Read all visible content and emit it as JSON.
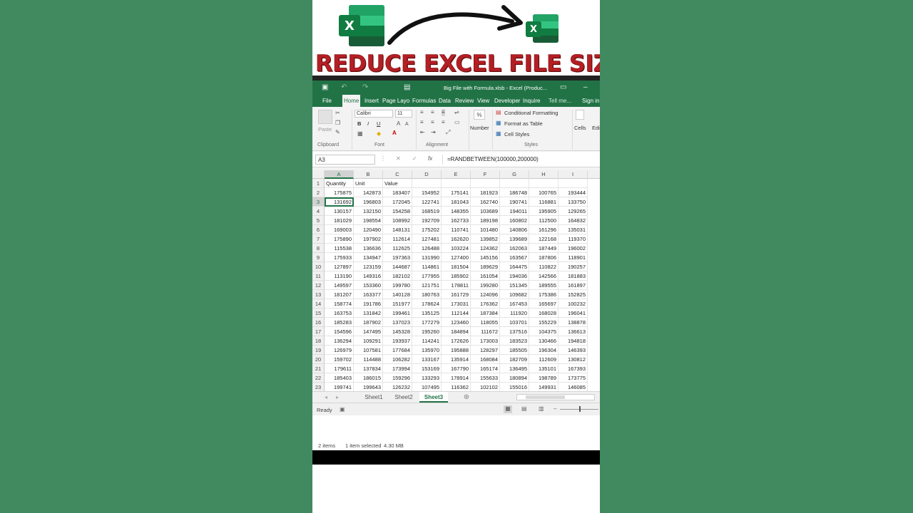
{
  "banner": {
    "headline": "REDUCE EXCEL FILE SIZE",
    "logo_letter": "X",
    "brand_color": "#107c41",
    "headline_color": "#b51f24"
  },
  "titlebar": {
    "title": "Big File with Formula.xlsb - Excel (Produc...",
    "icons": [
      "save-icon",
      "undo-icon",
      "redo-icon",
      "customize-icon",
      "ribbon-display-icon",
      "minimize-icon"
    ]
  },
  "menu": {
    "items": [
      "File",
      "Home",
      "Insert",
      "Page Layo",
      "Formulas",
      "Data",
      "Review",
      "View",
      "Developer",
      "Inquire",
      "Tell me...",
      "Sign in"
    ],
    "active": "Home"
  },
  "ribbon": {
    "paste": "Paste",
    "font_name": "Calibri",
    "font_size": "11",
    "bold": "B",
    "italic": "I",
    "underline": "U",
    "number": "Number",
    "percent": "%",
    "conditional_formatting": "Conditional Formatting",
    "format_as_table": "Format as Table",
    "cell_styles": "Cell Styles",
    "cells": "Cells",
    "editing": "Edi",
    "groups": [
      "Clipboard",
      "Font",
      "Alignment",
      "Styles"
    ]
  },
  "formula_bar": {
    "name_box": "A3",
    "formula": "=RANDBETWEEN(100000,200000)"
  },
  "grid": {
    "columns": [
      "A",
      "B",
      "C",
      "D",
      "E",
      "F",
      "G",
      "H",
      "I"
    ],
    "header_row": [
      "Quantity",
      "Unit",
      "Value",
      "",
      "",
      "",
      "",
      "",
      ""
    ],
    "rows": [
      [
        "175875",
        "142873",
        "183407",
        "154952",
        "175141",
        "181923",
        "186748",
        "100765",
        "193444"
      ],
      [
        "131692",
        "196803",
        "172045",
        "122741",
        "181043",
        "162740",
        "190741",
        "116881",
        "133750"
      ],
      [
        "130157",
        "132150",
        "154258",
        "168519",
        "148355",
        "103689",
        "194011",
        "195905",
        "129265"
      ],
      [
        "181029",
        "198554",
        "108992",
        "192709",
        "162733",
        "189198",
        "160802",
        "112500",
        "164832"
      ],
      [
        "169003",
        "120490",
        "148131",
        "175202",
        "110741",
        "101480",
        "140806",
        "161296",
        "135031"
      ],
      [
        "175890",
        "197902",
        "112614",
        "127481",
        "162620",
        "139852",
        "139689",
        "122168",
        "119370"
      ],
      [
        "115538",
        "136636",
        "112625",
        "126488",
        "103224",
        "124362",
        "162063",
        "187449",
        "196002"
      ],
      [
        "175933",
        "134947",
        "197363",
        "131990",
        "127400",
        "145156",
        "163567",
        "187806",
        "118901"
      ],
      [
        "127897",
        "123159",
        "144687",
        "114861",
        "181504",
        "189629",
        "164475",
        "110822",
        "190257"
      ],
      [
        "113190",
        "149316",
        "182102",
        "177955",
        "185902",
        "161054",
        "194036",
        "142566",
        "181883"
      ],
      [
        "149597",
        "153360",
        "199780",
        "121751",
        "178811",
        "199280",
        "151345",
        "189555",
        "161897"
      ],
      [
        "181207",
        "163377",
        "140128",
        "180763",
        "161729",
        "124096",
        "109682",
        "175386",
        "152825"
      ],
      [
        "158774",
        "191786",
        "151977",
        "178624",
        "173031",
        "176362",
        "167453",
        "165697",
        "100232"
      ],
      [
        "163753",
        "131842",
        "199461",
        "135125",
        "112144",
        "187384",
        "111920",
        "168028",
        "196041"
      ],
      [
        "185283",
        "187902",
        "137023",
        "177279",
        "123460",
        "118055",
        "103701",
        "155229",
        "138878"
      ],
      [
        "154596",
        "147495",
        "145328",
        "195260",
        "184894",
        "111672",
        "137516",
        "104375",
        "136613"
      ],
      [
        "136294",
        "109291",
        "193937",
        "114241",
        "172626",
        "173003",
        "183523",
        "130466",
        "194818"
      ],
      [
        "126979",
        "107581",
        "177684",
        "135970",
        "195888",
        "128297",
        "185505",
        "196304",
        "146393"
      ],
      [
        "159702",
        "114488",
        "106282",
        "133167",
        "135914",
        "168084",
        "182709",
        "112609",
        "130812"
      ],
      [
        "179611",
        "137834",
        "173994",
        "153169",
        "167790",
        "165174",
        "136495",
        "135101",
        "167393"
      ],
      [
        "185403",
        "186015",
        "159296",
        "133293",
        "178914",
        "155633",
        "180894",
        "198789",
        "173775"
      ],
      [
        "199741",
        "199643",
        "126232",
        "107495",
        "116362",
        "102102",
        "155016",
        "149931",
        "146085"
      ]
    ],
    "row_numbers": [
      "1",
      "2",
      "3",
      "4",
      "5",
      "6",
      "7",
      "8",
      "9",
      "10",
      "11",
      "12",
      "13",
      "14",
      "15",
      "16",
      "17",
      "18",
      "19",
      "20",
      "21",
      "22",
      "23"
    ]
  },
  "sheets": {
    "tabs": [
      "Sheet1",
      "Sheet2",
      "Sheet3"
    ],
    "active": "Sheet3"
  },
  "status": {
    "ready": "Ready"
  },
  "explorer": {
    "items_count": "2 items",
    "selected": "1 item selected",
    "size": "4.30 MB"
  }
}
